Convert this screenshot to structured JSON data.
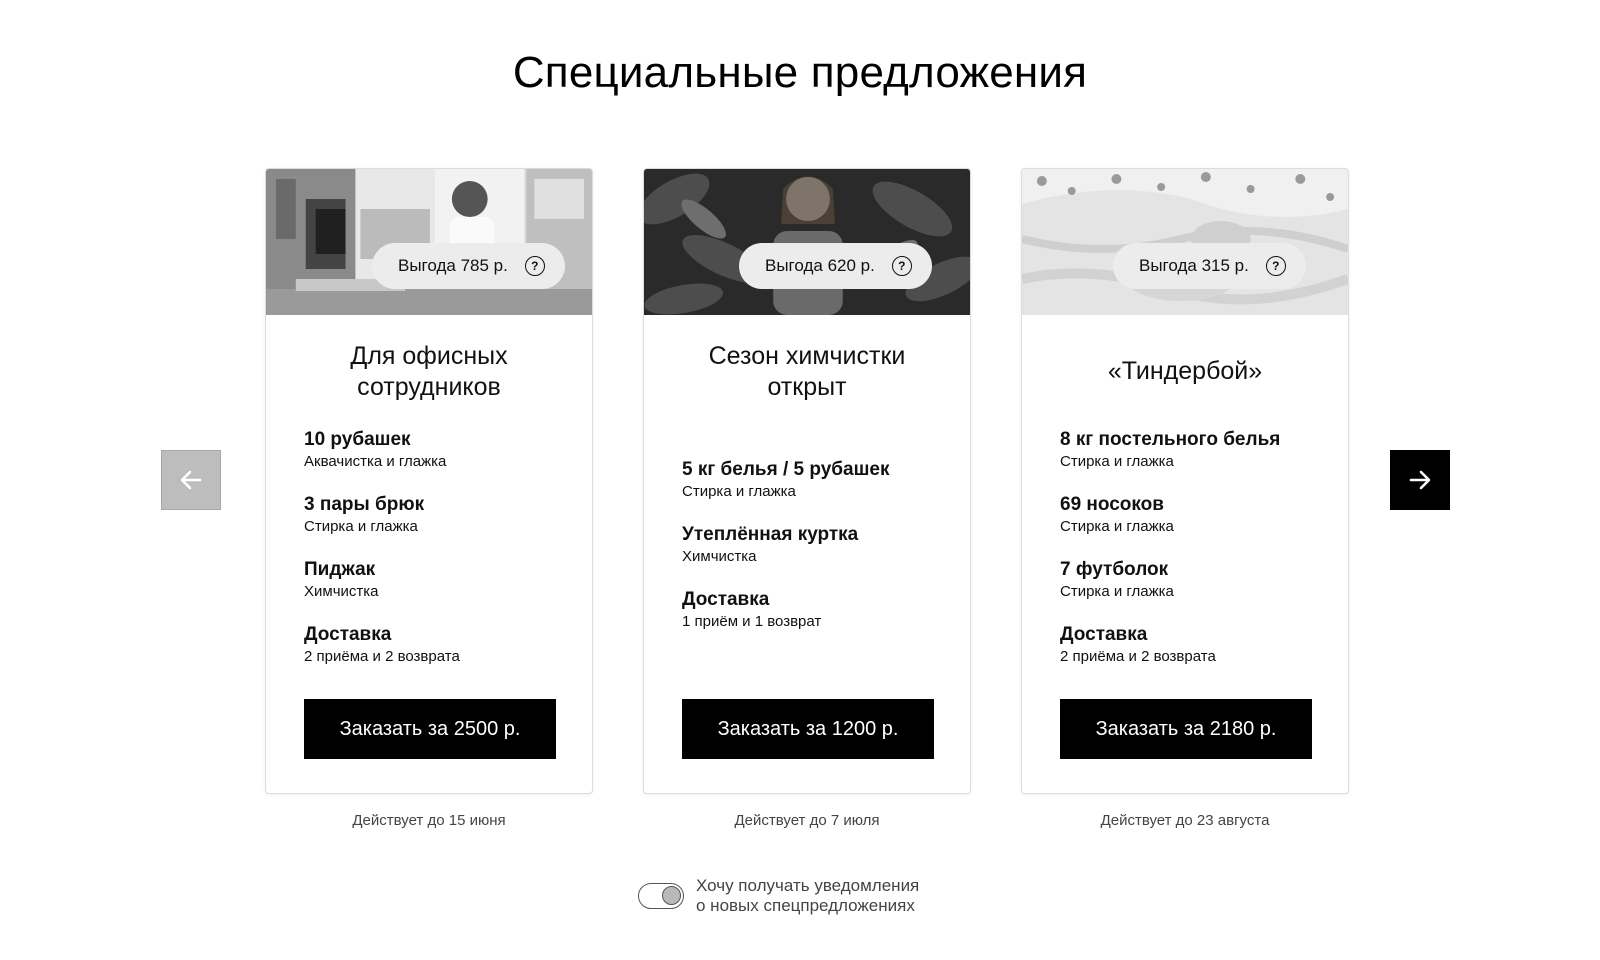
{
  "page": {
    "title": "Специальные предложения"
  },
  "navigation": {
    "prev_icon": "arrow-left-icon",
    "next_icon": "arrow-right-icon"
  },
  "offers": [
    {
      "benefit": "Выгода 785 р.",
      "help_icon": "question-icon",
      "title_line1": "Для офисных",
      "title_line2": "сотрудников",
      "items": [
        {
          "title": "10 рубашек",
          "subtitle": "Аквачистка и глажка"
        },
        {
          "title": "3 пары брюк",
          "subtitle": "Стирка и глажка"
        },
        {
          "title": "Пиджак",
          "subtitle": "Химчистка"
        },
        {
          "title": "Доставка",
          "subtitle": "2 приёма и 2 возврата"
        }
      ],
      "button": "Заказать за 2500 р.",
      "valid_until": "Действует до 15 июня"
    },
    {
      "benefit": "Выгода 620 р.",
      "help_icon": "question-icon",
      "title_line1": "Сезон химчистки",
      "title_line2": "открыт",
      "items": [
        {
          "title": "5 кг белья / 5 рубашек",
          "subtitle": "Стирка и глажка"
        },
        {
          "title": "Утеплённая куртка",
          "subtitle": "Химчистка"
        },
        {
          "title": "Доставка",
          "subtitle": "1 приём и 1 возврат"
        }
      ],
      "button": "Заказать за 1200 р.",
      "valid_until": "Действует до 7 июля"
    },
    {
      "benefit": "Выгода 315 р.",
      "help_icon": "question-icon",
      "title_line1": "«Тиндербой»",
      "items": [
        {
          "title": "8 кг постельного белья",
          "subtitle": "Стирка и глажка"
        },
        {
          "title": "69 носоков",
          "subtitle": "Стирка и глажка"
        },
        {
          "title": "7 футболок",
          "subtitle": "Стирка и глажка"
        },
        {
          "title": "Доставка",
          "subtitle": "2 приёма и 2 возврата"
        }
      ],
      "button": "Заказать за 2180 р.",
      "valid_until": "Действует до 23 августа"
    }
  ],
  "notifications": {
    "label_line1": "Хочу получать уведомления",
    "label_line2": "о новых спецпредложениях",
    "enabled": true
  },
  "colors": {
    "button_bg": "#000000",
    "arrow_disabled": "#bdbdbd",
    "badge_bg": "#ececec"
  }
}
